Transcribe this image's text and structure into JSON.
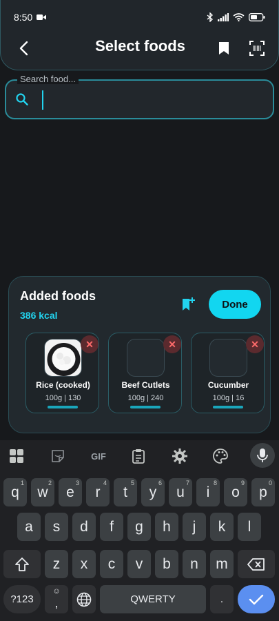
{
  "status": {
    "time": "8:50"
  },
  "header": {
    "title": "Select foods"
  },
  "search": {
    "label": "Search food...",
    "value": ""
  },
  "added": {
    "title": "Added foods",
    "kcal": "386 kcal",
    "done_label": "Done",
    "items": [
      {
        "name": "Rice (cooked)",
        "qty": "100g | 130"
      },
      {
        "name": "Beef Cutlets",
        "qty": "100g | 240"
      },
      {
        "name": "Cucumber",
        "qty": "100g | 16"
      }
    ]
  },
  "keyboard": {
    "gif_label": "GIF",
    "row1": [
      {
        "k": "q",
        "h": "1"
      },
      {
        "k": "w",
        "h": "2"
      },
      {
        "k": "e",
        "h": "3"
      },
      {
        "k": "r",
        "h": "4"
      },
      {
        "k": "t",
        "h": "5"
      },
      {
        "k": "y",
        "h": "6"
      },
      {
        "k": "u",
        "h": "7"
      },
      {
        "k": "i",
        "h": "8"
      },
      {
        "k": "o",
        "h": "9"
      },
      {
        "k": "p",
        "h": "0"
      }
    ],
    "row2": [
      "a",
      "s",
      "d",
      "f",
      "g",
      "h",
      "j",
      "k",
      "l"
    ],
    "row3": [
      "z",
      "x",
      "c",
      "v",
      "b",
      "n",
      "m"
    ],
    "symbols_label": "?123",
    "comma_label": ",",
    "space_label": "QWERTY",
    "period_label": "."
  },
  "colors": {
    "accent": "#22d3ee",
    "done_bg": "#12d6f0",
    "enter_bg": "#5b8ff0"
  }
}
